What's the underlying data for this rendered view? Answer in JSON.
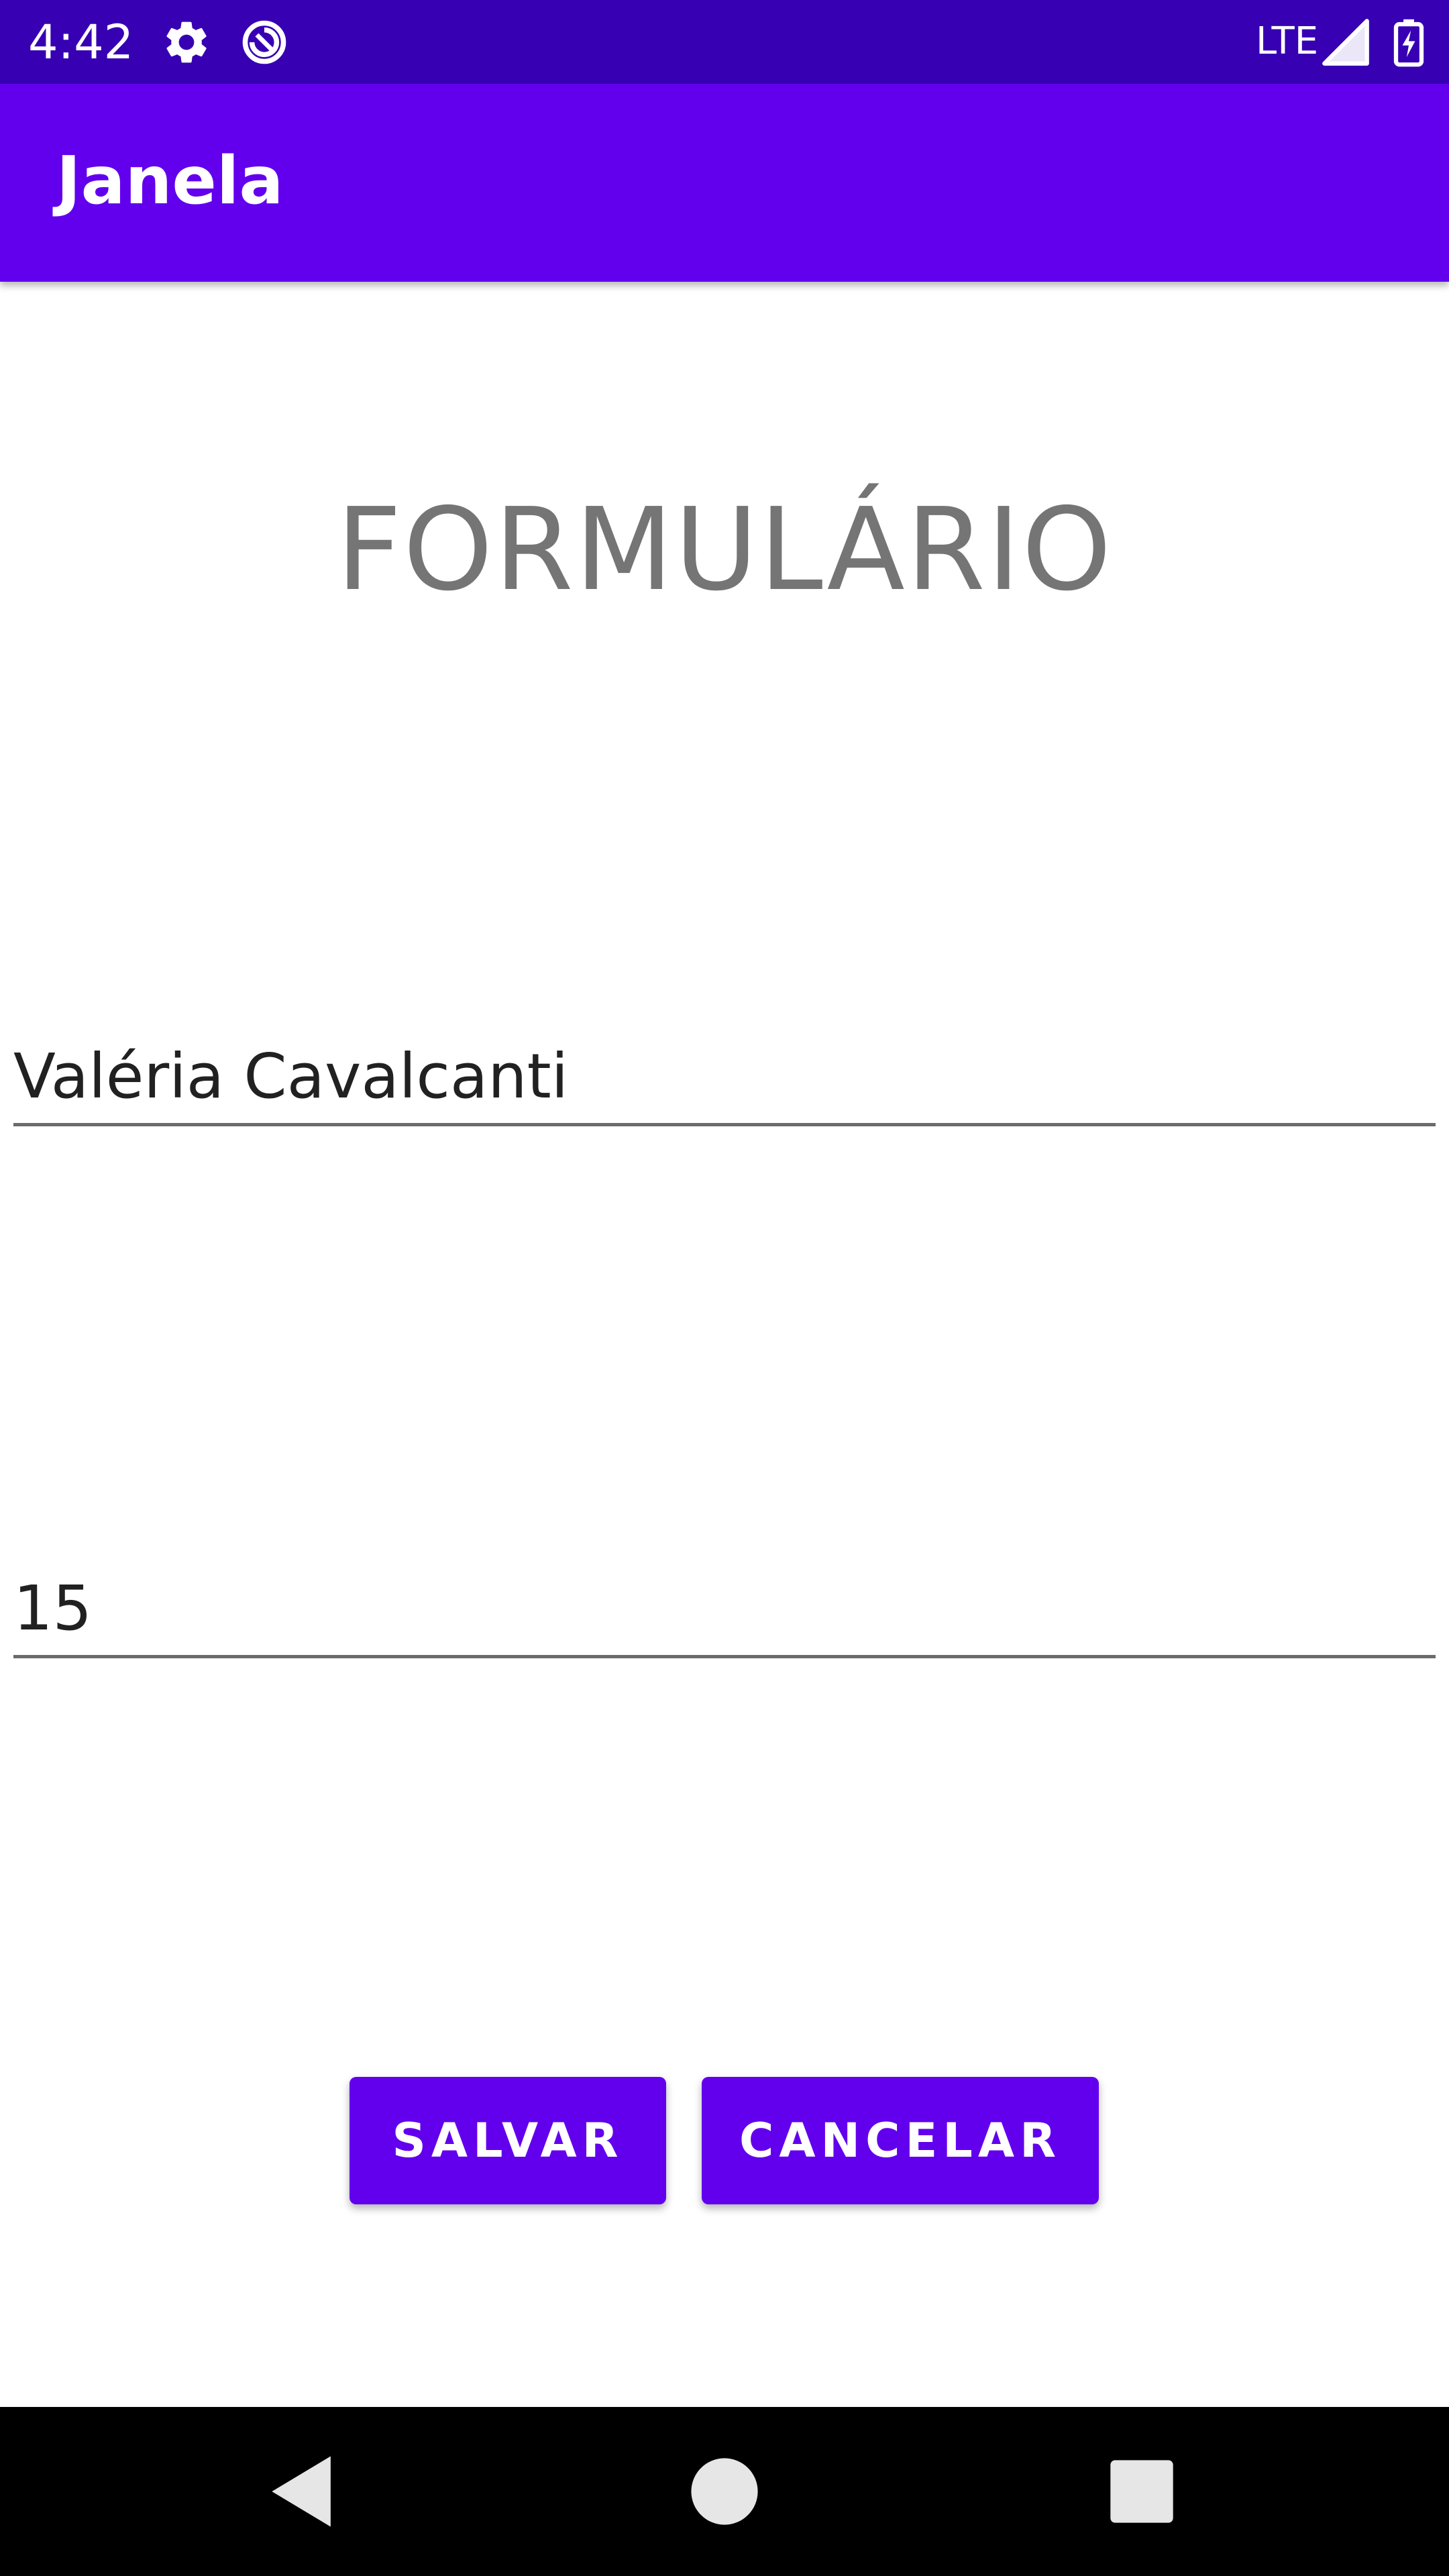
{
  "status_bar": {
    "time": "4:42",
    "network": "LTE",
    "icons": [
      "settings-icon",
      "data-saver-icon",
      "signal-icon",
      "battery-charging-icon"
    ]
  },
  "app_bar": {
    "title": "Janela"
  },
  "form": {
    "heading": "FORMULÁRIO",
    "name_value": "Valéria Cavalcanti",
    "number_value": "15"
  },
  "buttons": {
    "save_label": "SALVAR",
    "cancel_label": "CANCELAR"
  },
  "navigation": {
    "icons": [
      "back-icon",
      "home-icon",
      "recents-icon"
    ]
  },
  "colors": {
    "status_bar": "#3700b3",
    "primary": "#6200ee",
    "heading_text": "#757575",
    "field_text": "#212121"
  }
}
